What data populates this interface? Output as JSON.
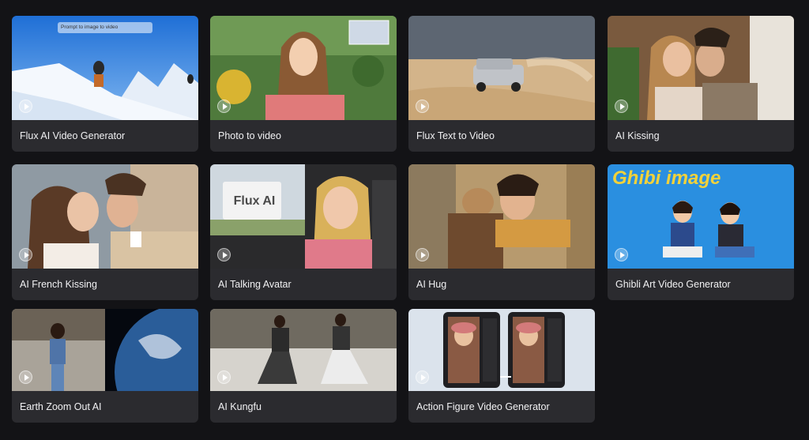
{
  "cards": [
    {
      "title": "Flux AI Video Generator",
      "overlay": "Prompt to image to video"
    },
    {
      "title": "Photo to video"
    },
    {
      "title": "Flux Text to Video"
    },
    {
      "title": "AI Kissing"
    },
    {
      "title": "AI French Kissing"
    },
    {
      "title": "AI Talking Avatar",
      "overlay": "Flux AI"
    },
    {
      "title": "AI Hug"
    },
    {
      "title": "Ghibli Art Video Generator",
      "overlay": "Ghibi image"
    },
    {
      "title": "Earth Zoom Out AI"
    },
    {
      "title": "AI Kungfu"
    },
    {
      "title": "Action Figure Video Generator"
    }
  ],
  "colors": {
    "background": "#131316",
    "card": "#2b2b2f",
    "label": "#f1f1f3"
  }
}
